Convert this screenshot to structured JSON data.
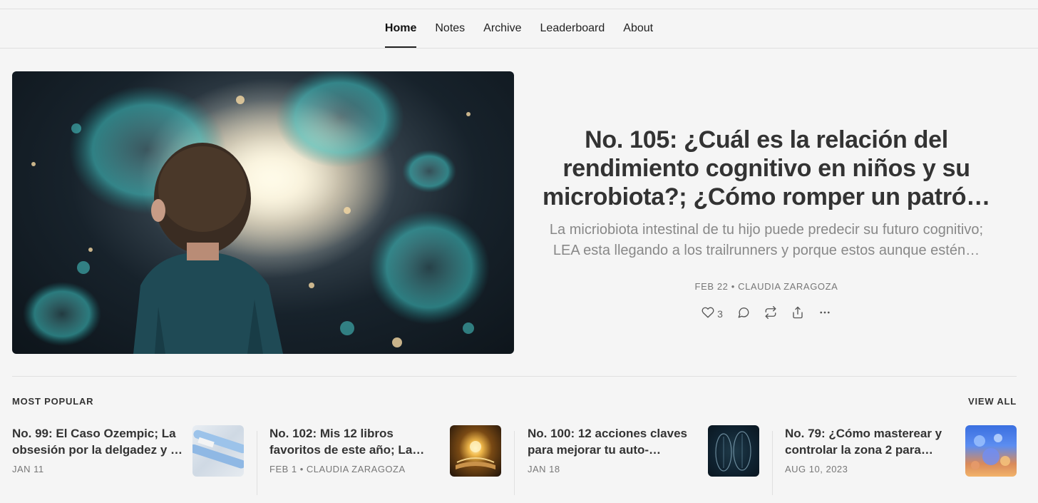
{
  "nav": {
    "items": [
      {
        "label": "Home",
        "active": true
      },
      {
        "label": "Notes",
        "active": false
      },
      {
        "label": "Archive",
        "active": false
      },
      {
        "label": "Leaderboard",
        "active": false
      },
      {
        "label": "About",
        "active": false
      }
    ]
  },
  "hero": {
    "title": "No. 105: ¿Cuál es la relación del rendimiento cognitivo en niños y su microbiota?; ¿Cómo romper un patró…",
    "subtitle": "La micriobiota intestinal de tu hijo puede predecir su futuro cognitivo; LEA esta llegando a los trailrunners y porque estos aunque estén…",
    "meta": "FEB 22 • CLAUDIA ZARAGOZA",
    "likes": "3",
    "icons": [
      "heart-icon",
      "comment-icon",
      "restack-icon",
      "share-icon",
      "more-icon"
    ]
  },
  "popular": {
    "label": "MOST POPULAR",
    "view_all": "VIEW ALL",
    "posts": [
      {
        "title": "No. 99: El Caso Ozempic; La obsesión por la delgadez y …",
        "meta": "JAN 11"
      },
      {
        "title": "No. 102: Mis 12 libros favoritos de este año; La…",
        "meta": "FEB 1 • CLAUDIA ZARAGOZA"
      },
      {
        "title": "No. 100: 12 acciones claves para mejorar tu auto-…",
        "meta": "JAN 18"
      },
      {
        "title": "No. 79: ¿Cómo masterear y controlar la zona 2 para…",
        "meta": "AUG 10, 2023"
      }
    ]
  },
  "colors": {
    "background": "#f5f5f5",
    "text": "#333333",
    "muted": "#888888",
    "border": "#e0e0e0"
  }
}
